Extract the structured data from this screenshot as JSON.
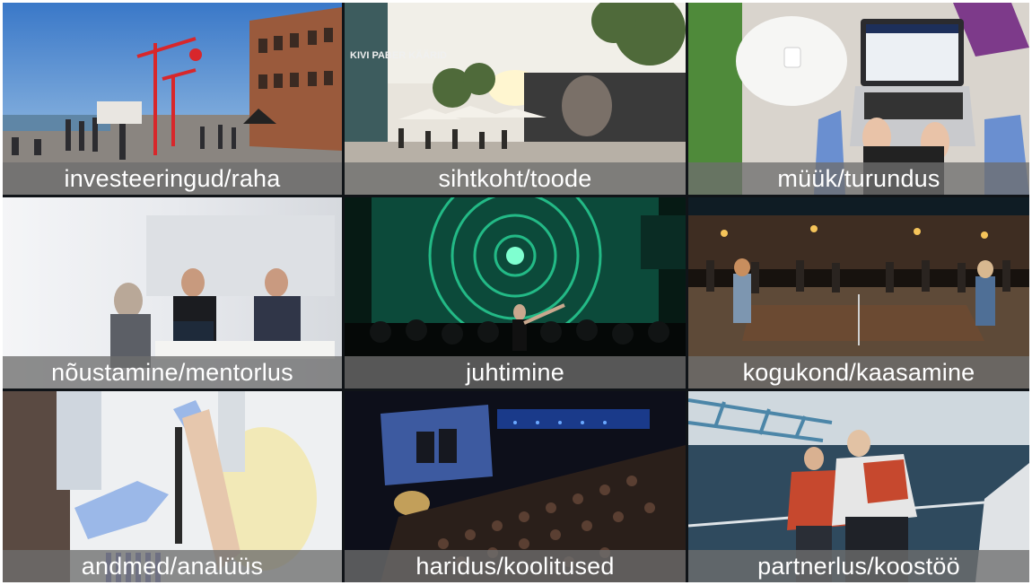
{
  "tiles": [
    {
      "label": "investeeringud/raha",
      "scene": "harbour-promenade"
    },
    {
      "label": "sihtkoht/toode",
      "scene": "outdoor-terrace",
      "sign_text": "KIVI PABER KÄÄRID"
    },
    {
      "label": "müük/turundus",
      "scene": "laptop-on-table"
    },
    {
      "label": "nõustamine/mentorlus",
      "scene": "office-meeting"
    },
    {
      "label": "juhtimine",
      "scene": "concert-stage"
    },
    {
      "label": "kogukond/kaasamine",
      "scene": "night-table-tennis"
    },
    {
      "label": "andmed/analüüs",
      "scene": "lab-test-tube"
    },
    {
      "label": "haridus/koolitused",
      "scene": "auditorium-audience"
    },
    {
      "label": "partnerlus/koostöö",
      "scene": "sailing-crew"
    }
  ]
}
